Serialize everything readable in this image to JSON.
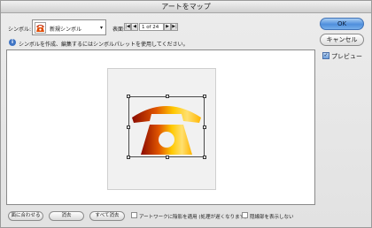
{
  "window": {
    "title": "アートをマップ"
  },
  "symbol": {
    "label": "シンボル:",
    "selected": "新規シンボル"
  },
  "page": {
    "label": "表面:",
    "value": "1 of 24"
  },
  "buttons": {
    "ok": "OK",
    "cancel": "キャンセル"
  },
  "preview": {
    "label": "プレビュー",
    "checked": true
  },
  "info": {
    "text": "シンボルを作成、編集するにはシンボルパレットを使用してください。"
  },
  "bottom": {
    "fit_label": "面に合わせる",
    "clear_label": "消去",
    "clear_all_label": "すべて消去",
    "shade_label": "アートワークに陰影を適用 (処理が遅くなります)",
    "hidden_label": "隠線部を表示しない"
  },
  "colors": {
    "accent": "#4f8fdc",
    "art_dark": "#8a0a00",
    "art_light": "#ffc800"
  }
}
